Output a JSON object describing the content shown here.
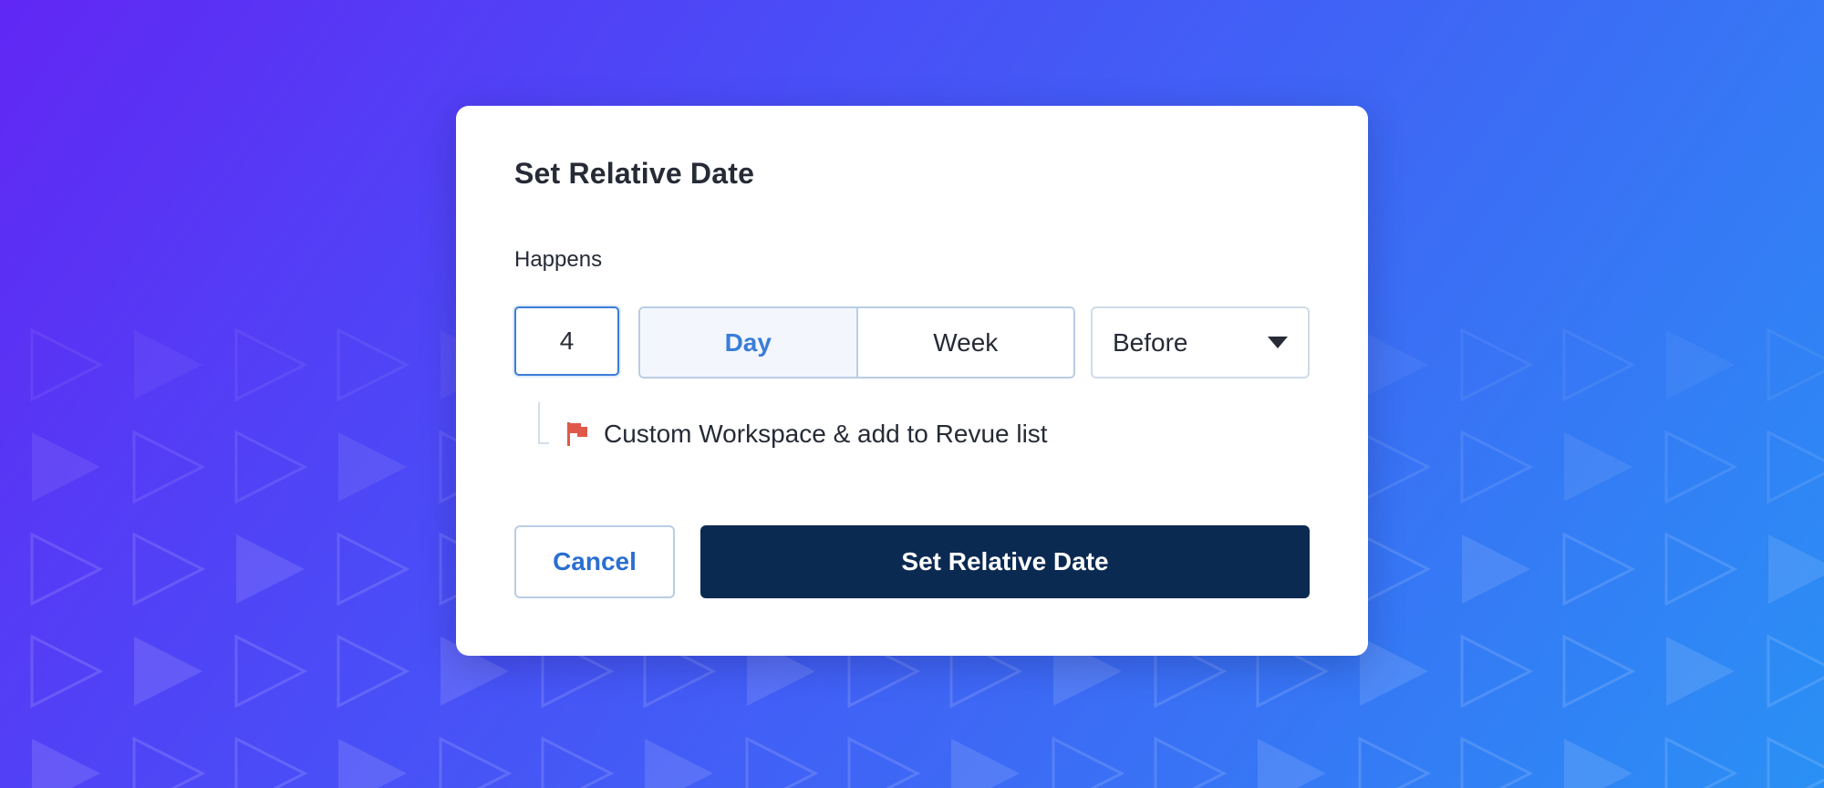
{
  "colors": {
    "background_start": "#6127f4",
    "background_end": "#2a90f5",
    "accent": "#3b7dd8",
    "primary_button": "#0b2a52",
    "flag": "#e0584a"
  },
  "dialog": {
    "title": "Set Relative Date",
    "field_label": "Happens",
    "amount": {
      "value": "4"
    },
    "unit": {
      "options": [
        {
          "label": "Day",
          "selected": true
        },
        {
          "label": "Week",
          "selected": false
        }
      ]
    },
    "direction": {
      "value": "Before",
      "icon": "caret-down-icon"
    },
    "task": {
      "icon": "flag-icon",
      "label": "Custom Workspace & add to Revue list"
    },
    "actions": {
      "cancel_label": "Cancel",
      "confirm_label": "Set Relative Date"
    }
  }
}
